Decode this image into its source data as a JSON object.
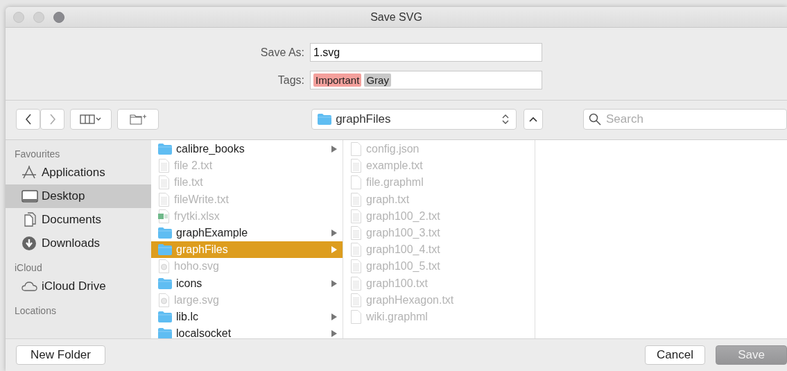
{
  "window": {
    "title": "Save SVG"
  },
  "save_as": {
    "label": "Save As:",
    "value": "1.svg"
  },
  "tags": {
    "label": "Tags:",
    "items": [
      {
        "text": "Important",
        "color": "#f4a09c"
      },
      {
        "text": "Gray",
        "color": "#c8c8c8"
      }
    ]
  },
  "toolbar": {
    "location": "graphFiles",
    "search": {
      "placeholder": "Search"
    }
  },
  "sidebar": [
    {
      "title": "Favourites",
      "items": [
        {
          "label": "Applications",
          "kind": "apps",
          "selected": false
        },
        {
          "label": "Desktop",
          "kind": "desktop",
          "selected": true
        },
        {
          "label": "Documents",
          "kind": "documents",
          "selected": false
        },
        {
          "label": "Downloads",
          "kind": "downloads",
          "selected": false
        }
      ]
    },
    {
      "title": "iCloud",
      "items": [
        {
          "label": "iCloud Drive",
          "kind": "cloud",
          "selected": false
        }
      ]
    },
    {
      "title": "Locations"
    }
  ],
  "columns": [
    [
      {
        "name": "calibre_books",
        "kind": "folder",
        "selected": false,
        "disabled": false
      },
      {
        "name": "file 2.txt",
        "kind": "text",
        "selected": false,
        "disabled": true
      },
      {
        "name": "file.txt",
        "kind": "text",
        "selected": false,
        "disabled": true
      },
      {
        "name": "fileWrite.txt",
        "kind": "text",
        "selected": false,
        "disabled": true
      },
      {
        "name": "frytki.xlsx",
        "kind": "sheet",
        "selected": false,
        "disabled": true
      },
      {
        "name": "graphExample",
        "kind": "folder",
        "selected": false,
        "disabled": false
      },
      {
        "name": "graphFiles",
        "kind": "folder",
        "selected": true,
        "disabled": false
      },
      {
        "name": "hoho.svg",
        "kind": "svg",
        "selected": false,
        "disabled": true
      },
      {
        "name": "icons",
        "kind": "folder",
        "selected": false,
        "disabled": false
      },
      {
        "name": "large.svg",
        "kind": "svg",
        "selected": false,
        "disabled": true
      },
      {
        "name": "lib.lc",
        "kind": "folder",
        "selected": false,
        "disabled": false
      },
      {
        "name": "localsocket",
        "kind": "folder",
        "selected": false,
        "disabled": false
      }
    ],
    [
      {
        "name": "config.json",
        "kind": "blank",
        "selected": false,
        "disabled": true
      },
      {
        "name": "example.txt",
        "kind": "text",
        "selected": false,
        "disabled": true
      },
      {
        "name": "file.graphml",
        "kind": "blank",
        "selected": false,
        "disabled": true
      },
      {
        "name": "graph.txt",
        "kind": "text",
        "selected": false,
        "disabled": true
      },
      {
        "name": "graph100_2.txt",
        "kind": "text",
        "selected": false,
        "disabled": true
      },
      {
        "name": "graph100_3.txt",
        "kind": "text",
        "selected": false,
        "disabled": true
      },
      {
        "name": "graph100_4.txt",
        "kind": "text",
        "selected": false,
        "disabled": true
      },
      {
        "name": "graph100_5.txt",
        "kind": "text",
        "selected": false,
        "disabled": true
      },
      {
        "name": "graph100.txt",
        "kind": "text",
        "selected": false,
        "disabled": true
      },
      {
        "name": "graphHexagon.txt",
        "kind": "text",
        "selected": false,
        "disabled": true
      },
      {
        "name": "wiki.graphml",
        "kind": "blank",
        "selected": false,
        "disabled": true
      }
    ]
  ],
  "buttons": {
    "left": [
      {
        "label": "New Folder",
        "kind": "plain"
      }
    ],
    "right": [
      {
        "label": "Cancel",
        "kind": "plain"
      },
      {
        "label": "Save",
        "kind": "default"
      }
    ]
  }
}
